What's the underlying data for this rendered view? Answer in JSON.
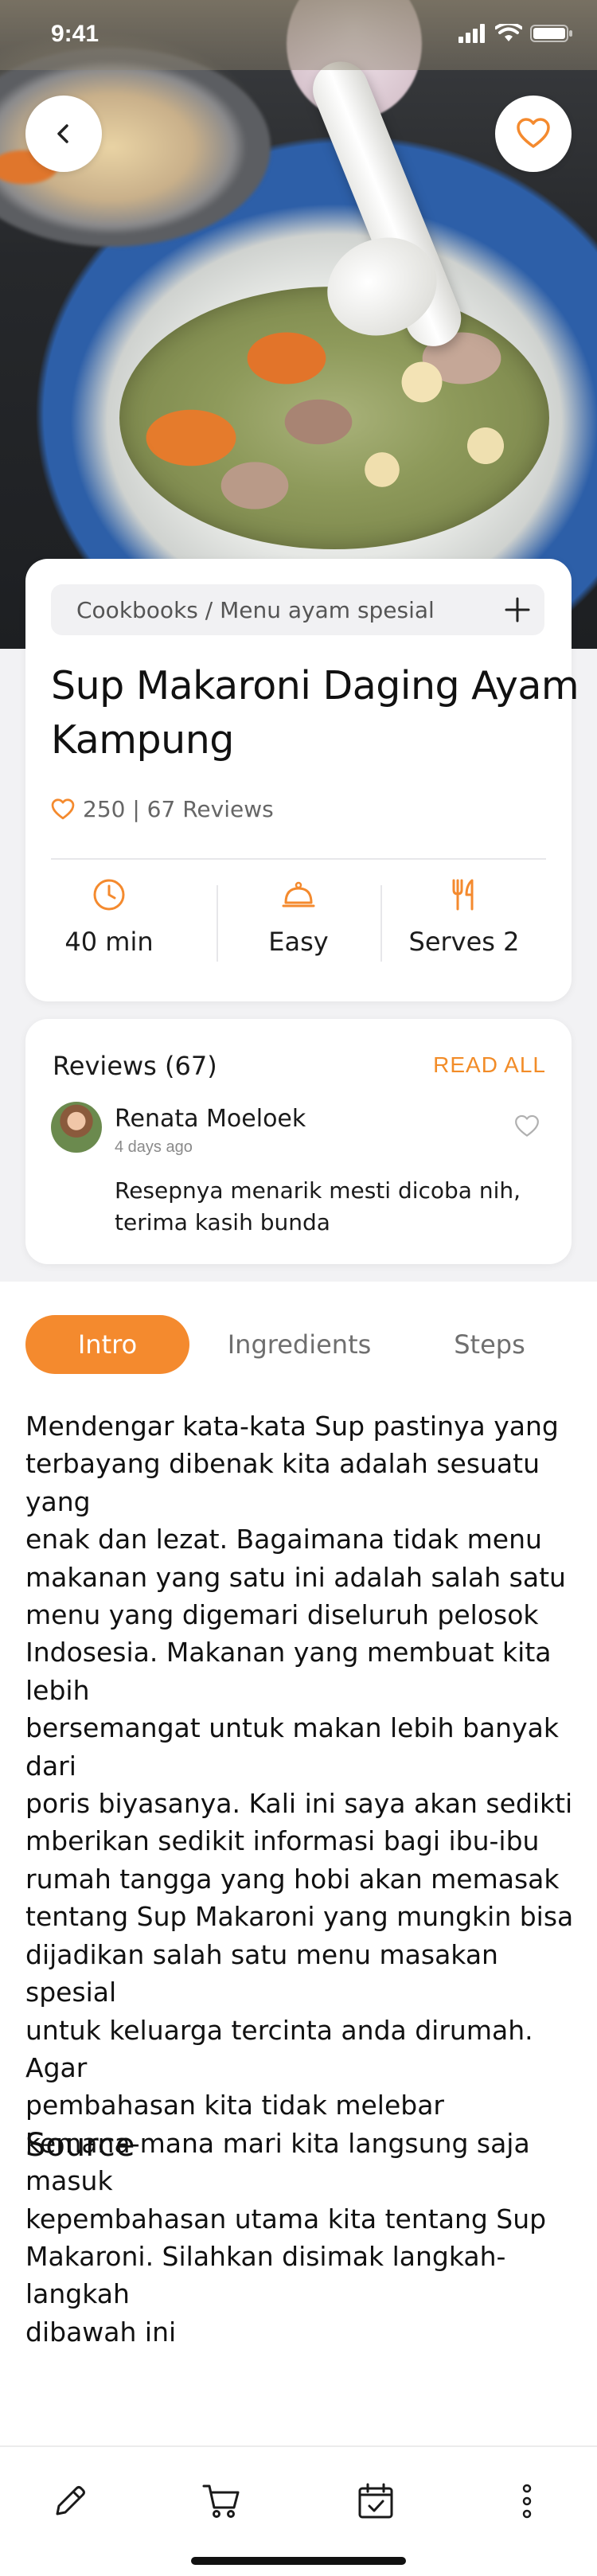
{
  "status_bar": {
    "time": "9:41"
  },
  "hero": {
    "back_icon": "chevron-left-icon",
    "favorite_icon": "heart-outline-icon"
  },
  "recipe": {
    "breadcrumb": "Cookbooks / Menu ayam spesial",
    "add_icon": "plus-icon",
    "title": "Sup Makaroni Daging Ayam\n Kampung",
    "likes_reviews": "250 | 67 Reviews",
    "stats": [
      {
        "icon": "clock-icon",
        "label": "40 min"
      },
      {
        "icon": "cloche-icon",
        "label": "Easy"
      },
      {
        "icon": "utensils-icon",
        "label": "Serves 2"
      }
    ]
  },
  "reviews": {
    "title": "Reviews (67)",
    "read_all": "READ ALL",
    "items": [
      {
        "name": "Renata Moeloek",
        "date": "4 days ago",
        "text": "Resepnya menarik mesti dicoba nih, terima kasih bunda"
      }
    ]
  },
  "tabs": [
    {
      "label": "Intro",
      "active": true
    },
    {
      "label": "Ingredients",
      "active": false
    },
    {
      "label": "Steps",
      "active": false
    }
  ],
  "intro": {
    "text": "Mendengar kata-kata Sup pastinya yang\nterbayang dibenak kita adalah sesuatu yang\nenak dan lezat. Bagaimana tidak menu\nmakanan yang satu ini adalah salah satu\nmenu yang digemari diseluruh pelosok\nIndosesia. Makanan yang membuat kita lebih\n bersemangat untuk makan lebih banyak dari\n poris biyasanya. Kali ini saya akan sedikti\nmberikan sedikit informasi bagi ibu-ibu\nrumah tangga yang hobi akan memasak\ntentang Sup Makaroni yang mungkin bisa\ndijadikan salah satu menu masakan spesial\nuntuk keluarga tercinta anda dirumah. Agar\npembahasan kita tidak melebar\nkemana-mana mari kita langsung saja masuk\n kepembahasan utama kita tentang Sup\nMakaroni. Silahkan disimak langkah-langkah\ndibawah ini",
    "source_heading": "Source"
  },
  "bottom_nav": [
    {
      "icon": "pencil-icon"
    },
    {
      "icon": "cart-icon"
    },
    {
      "icon": "calendar-check-icon"
    },
    {
      "icon": "more-vertical-icon"
    }
  ],
  "colors": {
    "accent": "#f48a2e",
    "background": "#f2f2f4"
  }
}
